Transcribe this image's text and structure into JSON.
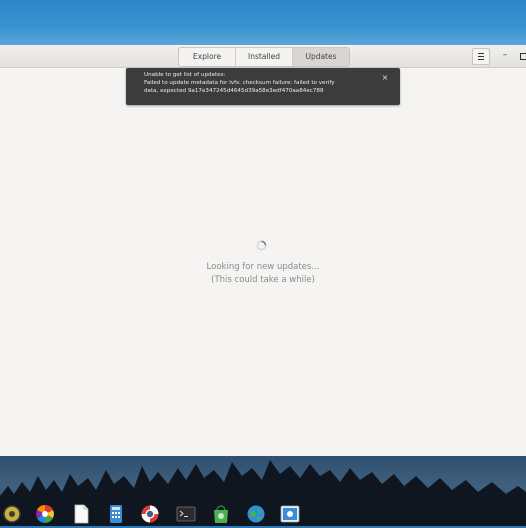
{
  "tabs": [
    {
      "label": "Explore"
    },
    {
      "label": "Installed"
    },
    {
      "label": "Updates"
    }
  ],
  "selected_tab": "Updates",
  "window_controls": {
    "minimize": "–",
    "maximize": "▢"
  },
  "notification": {
    "line1": "Unable to get list of updates:",
    "line2": "Failed to update metadata for lvfs: checksum failure: failed to verify",
    "line3": "data, expected 9a17e347245d4645d39a58e3edf470aa84ec788",
    "close": "×"
  },
  "status": {
    "line1": "Looking for new updates...",
    "line2": "(This could take a while)"
  },
  "dock": [
    {
      "icon": "system-settings-icon"
    },
    {
      "icon": "color-picker-icon"
    },
    {
      "icon": "text-document-icon"
    },
    {
      "icon": "calculator-icon"
    },
    {
      "icon": "help-lifebuoy-icon"
    },
    {
      "icon": "terminal-icon"
    },
    {
      "icon": "software-store-icon"
    },
    {
      "icon": "browser-globe-icon"
    },
    {
      "icon": "screenshot-camera-icon"
    }
  ],
  "colors": {
    "wallpaper": "#2b86c8",
    "window_bg": "#f5f4f2",
    "notification_bg": "#3c3c3c",
    "selected_tab_bg": "#d9d6d2"
  }
}
